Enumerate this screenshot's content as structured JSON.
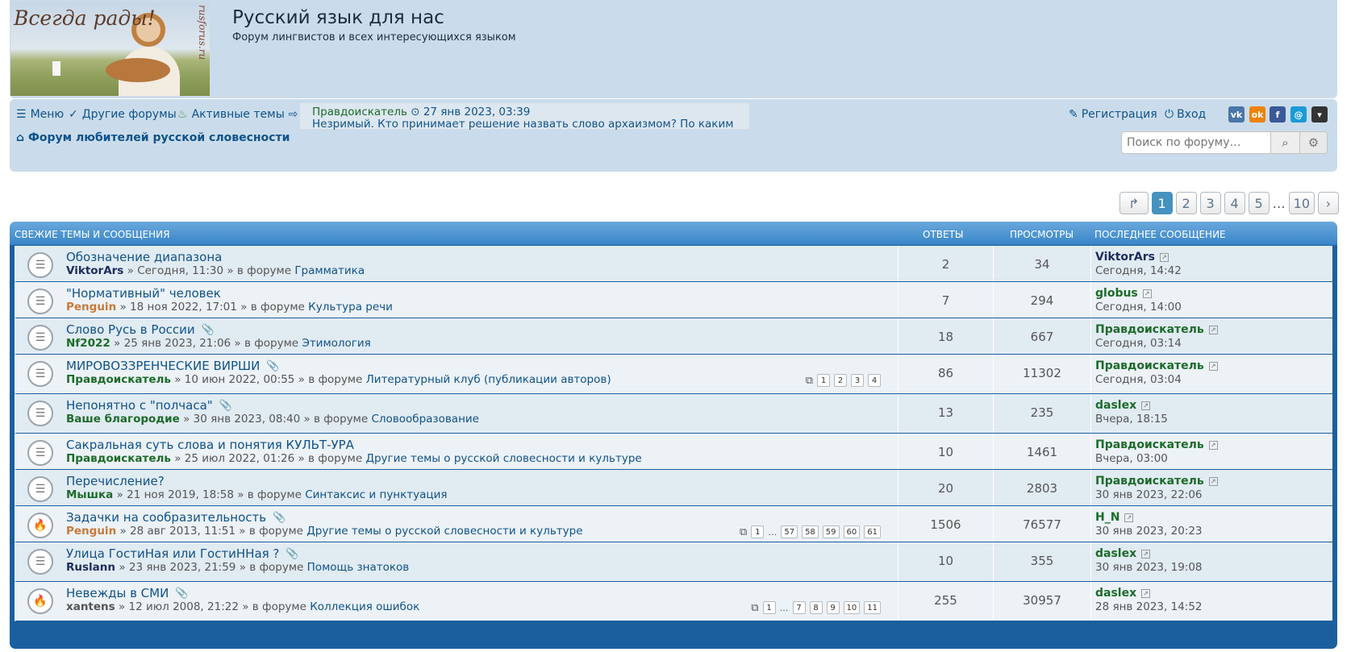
{
  "site": {
    "logo_text": "Всегда рады!",
    "logo_site": "rusforus.ru",
    "title": "Русский язык для нас",
    "description": "Форум лингвистов и всех интересующихся языком"
  },
  "nav": {
    "menu": "Меню",
    "other_forums": "Другие форумы",
    "active_topics": "Активные темы",
    "ticker_author": "Правдоискатель",
    "ticker_time": "27 янв 2023, 03:39",
    "ticker_text": "Незримый. Кто принимает решение назвать слово архаизмом? По каким",
    "register": "Регистрация",
    "login": "Вход",
    "social": [
      "vk-icon",
      "odnoklassniki-icon",
      "facebook-icon",
      "mail-icon",
      "dropdown-icon"
    ],
    "breadcrumb": "Форум любителей русской словесности",
    "search_placeholder": "Поиск по форуму…"
  },
  "pagination": [
    "1",
    "2",
    "3",
    "4",
    "5",
    "…",
    "10"
  ],
  "table": {
    "header": "Свежие темы и сообщения",
    "col_replies": "Ответы",
    "col_views": "Просмотры",
    "col_last": "Последнее сообщение"
  },
  "sep": "»",
  "in_forum": "в форуме",
  "topics": [
    {
      "title": "Обозначение диапазона",
      "author": "ViktorArs",
      "author_color": "#1d2c5e",
      "date": "Сегодня, 11:30",
      "forum": "Грамматика",
      "replies": "2",
      "views": "34",
      "last_author": "ViktorArs",
      "last_author_color": "#1d2c5e",
      "last_time": "Сегодня, 14:42",
      "attachment": false,
      "hot": false,
      "pages": []
    },
    {
      "title": "\"Нормативный\" человек",
      "author": "Penguin",
      "author_color": "#c77a3a",
      "date": "18 ноя 2022, 17:01",
      "forum": "Культура речи",
      "replies": "7",
      "views": "294",
      "last_author": "globus",
      "last_author_color": "#1c6b2a",
      "last_time": "Сегодня, 14:00",
      "attachment": false,
      "hot": false,
      "pages": []
    },
    {
      "title": "Слово Русь в России",
      "author": "Nf2022",
      "author_color": "#1c6b2a",
      "date": "25 янв 2023, 21:06",
      "forum": "Этимология",
      "replies": "18",
      "views": "667",
      "last_author": "Правдоискатель",
      "last_author_color": "#1c6b2a",
      "last_time": "Сегодня, 03:14",
      "attachment": true,
      "hot": false,
      "pages": []
    },
    {
      "title": "МИРОВОЗЗРЕНЧЕСКИЕ ВИРШИ",
      "author": "Правдоискатель",
      "author_color": "#1c6b2a",
      "date": "10 июн 2022, 00:55",
      "forum": "Литературный клуб (публикации авторов)",
      "replies": "86",
      "views": "11302",
      "last_author": "Правдоискатель",
      "last_author_color": "#1c6b2a",
      "last_time": "Сегодня, 03:04",
      "attachment": true,
      "hot": false,
      "pages": [
        "1",
        "2",
        "3",
        "4"
      ]
    },
    {
      "title": "Непонятно с \"полчаса\"",
      "author": "Ваше благородие",
      "author_color": "#1c6b2a",
      "date": "30 янв 2023, 08:40",
      "forum": "Словообразование",
      "replies": "13",
      "views": "235",
      "last_author": "daslex",
      "last_author_color": "#1c6b2a",
      "last_time": "Вчера, 18:15",
      "attachment": true,
      "hot": false,
      "pages": []
    },
    {
      "title": "Сакральная суть слова и понятия КУЛЬТ-УРА",
      "author": "Правдоискатель",
      "author_color": "#1c6b2a",
      "date": "25 июл 2022, 01:26",
      "forum": "Другие темы о русской словесности и культуре",
      "replies": "10",
      "views": "1461",
      "last_author": "Правдоискатель",
      "last_author_color": "#1c6b2a",
      "last_time": "Вчера, 03:00",
      "attachment": false,
      "hot": false,
      "pages": []
    },
    {
      "title": "Перечисление?",
      "author": "Мышка",
      "author_color": "#1c6b2a",
      "date": "21 ноя 2019, 18:58",
      "forum": "Синтаксис и пунктуация",
      "replies": "20",
      "views": "2803",
      "last_author": "Правдоискатель",
      "last_author_color": "#1c6b2a",
      "last_time": "30 янв 2023, 22:06",
      "attachment": false,
      "hot": false,
      "pages": []
    },
    {
      "title": "Задачки на сообразительность",
      "author": "Penguin",
      "author_color": "#c77a3a",
      "date": "28 авг 2013, 11:51",
      "forum": "Другие темы о русской словесности и культуре",
      "replies": "1506",
      "views": "76577",
      "last_author": "H_N",
      "last_author_color": "#1c6b2a",
      "last_time": "30 янв 2023, 20:23",
      "attachment": true,
      "hot": true,
      "pages": [
        "1",
        "…",
        "57",
        "58",
        "59",
        "60",
        "61"
      ]
    },
    {
      "title": "Улица ГостиНая или ГостиННая ?",
      "author": "Ruslann",
      "author_color": "#1d2c5e",
      "date": "23 янв 2023, 21:59",
      "forum": "Помощь знатоков",
      "replies": "10",
      "views": "355",
      "last_author": "daslex",
      "last_author_color": "#1c6b2a",
      "last_time": "30 янв 2023, 19:08",
      "attachment": true,
      "hot": false,
      "pages": []
    },
    {
      "title": "Невежды в СМИ",
      "author": "xantens",
      "author_color": "#555555",
      "date": "12 июл 2008, 21:22",
      "forum": "Коллекция ошибок",
      "replies": "255",
      "views": "30957",
      "last_author": "daslex",
      "last_author_color": "#1c6b2a",
      "last_time": "28 янв 2023, 14:52",
      "attachment": true,
      "hot": true,
      "pages": [
        "1",
        "…",
        "7",
        "8",
        "9",
        "10",
        "11"
      ]
    }
  ]
}
